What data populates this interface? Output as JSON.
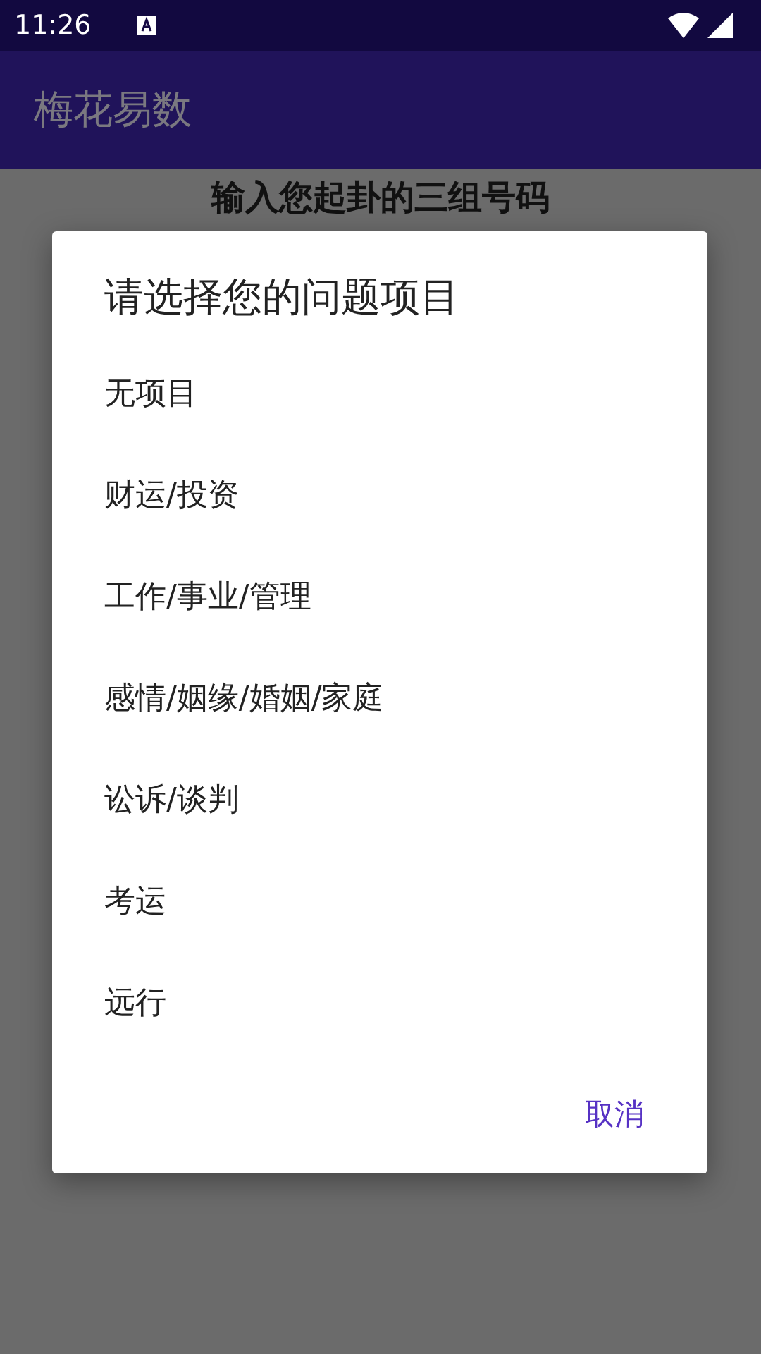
{
  "status_bar": {
    "time": "11:26"
  },
  "app_bar": {
    "title": "梅花易数"
  },
  "page": {
    "heading": "输入您起卦的三组号码"
  },
  "dialog": {
    "title": "请选择您的问题项目",
    "items": [
      "无项目",
      "财运/投资",
      "工作/事业/管理",
      "感情/姻缘/婚姻/家庭",
      "讼诉/谈判",
      "考运",
      "远行"
    ],
    "buttons": [
      "取消"
    ]
  }
}
